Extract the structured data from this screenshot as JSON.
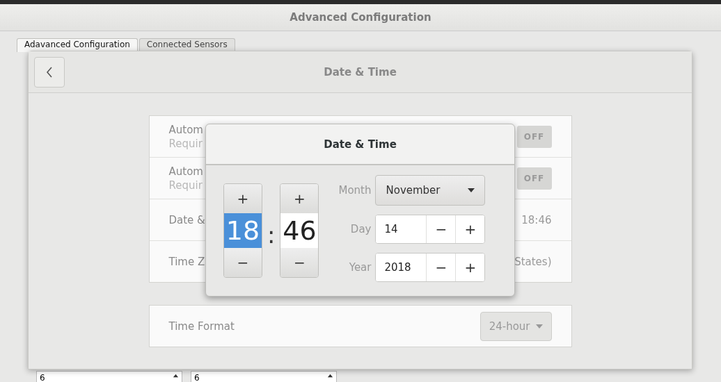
{
  "window": {
    "title": "Advanced Configuration"
  },
  "tabs": [
    {
      "label": "Adavanced Configuration",
      "selected": true
    },
    {
      "label": "Connected Sensors",
      "selected": false
    }
  ],
  "background_fields": [
    {
      "value": "6"
    },
    {
      "value": "6"
    }
  ],
  "settings_dialog": {
    "title": "Date & Time",
    "rows": [
      {
        "kind": "switch",
        "label": "Autom",
        "sublabel": "Requir",
        "switch_label": "OFF",
        "on": false
      },
      {
        "kind": "switch",
        "label": "Autom",
        "sublabel": "Requir",
        "switch_label": "OFF",
        "on": false
      },
      {
        "kind": "value",
        "label": "Date &",
        "value": "18:46"
      },
      {
        "kind": "value",
        "label": "Time Z",
        "value": "States)"
      }
    ],
    "time_format": {
      "label": "Time Format",
      "value": "24-hour",
      "disabled": true
    }
  },
  "popover": {
    "title": "Date & Time",
    "separator": ":",
    "spinners": [
      {
        "value": "18",
        "selected": true,
        "increment": "+",
        "decrement": "−"
      },
      {
        "value": "46",
        "selected": false,
        "increment": "+",
        "decrement": "−"
      }
    ],
    "fields": [
      {
        "kind": "dropdown",
        "label": "Month",
        "value": "November"
      },
      {
        "kind": "stepper",
        "label": "Day",
        "value": "14",
        "decrement": "−",
        "increment": "+"
      },
      {
        "kind": "stepper",
        "label": "Year",
        "value": "2018",
        "decrement": "−",
        "increment": "+"
      }
    ]
  }
}
